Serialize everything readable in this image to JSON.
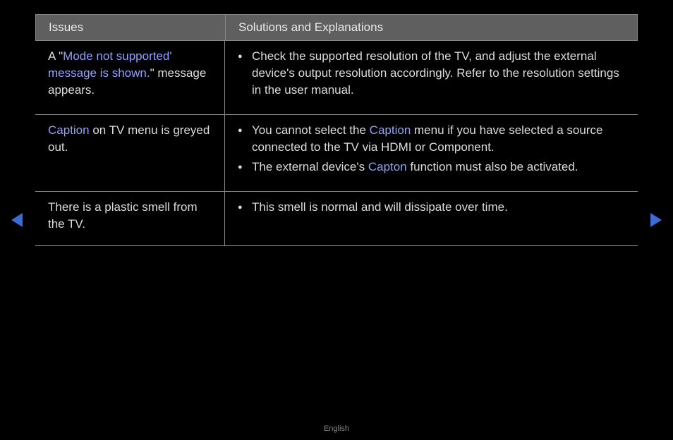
{
  "header": {
    "issues": "Issues",
    "solutions": "Solutions and Explanations"
  },
  "rows": [
    {
      "issue_pre": "A \"",
      "issue_hl": "Mode not supported' message is shown.",
      "issue_post": "\" message appears.",
      "sol1": "Check the supported resolution of the TV, and adjust the external device's output resolution accordingly. Refer to the resolution settings in the user manual."
    },
    {
      "issue_hl": "Caption",
      "issue_post": " on TV menu is greyed out.",
      "sol1a": "You cannot select the ",
      "sol1b": "Caption",
      "sol1c": " menu if you have selected a source connected to the TV via HDMI or Component.",
      "sol2a": "The external device's ",
      "sol2b": "Capton",
      "sol2c": " function must also be activated."
    },
    {
      "issue": "There is a plastic smell from the TV.",
      "sol1": "This smell is normal and will dissipate over time."
    }
  ],
  "footer": {
    "language": "English"
  },
  "colors": {
    "highlight": "#8fa0ff",
    "nav_arrow": "#3b6bd6"
  }
}
